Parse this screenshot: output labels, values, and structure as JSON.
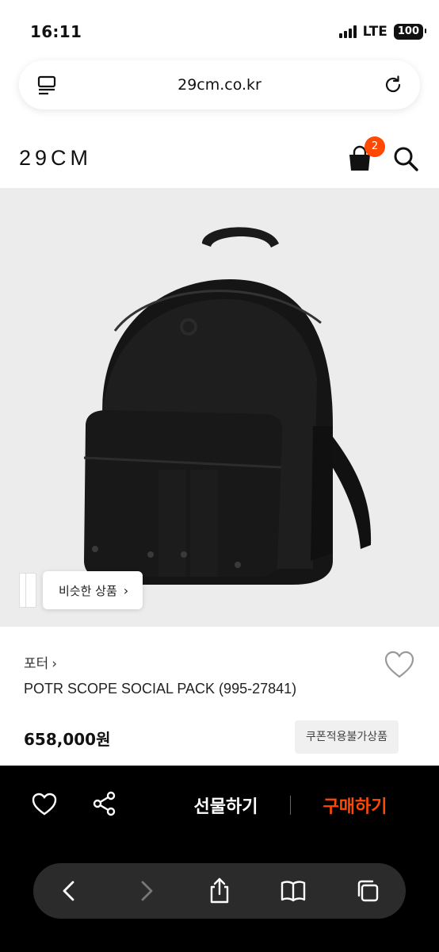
{
  "status_bar": {
    "time": "16:11",
    "network": "LTE",
    "battery": "100"
  },
  "browser": {
    "url": "29cm.co.kr",
    "menu_icon": "tab-menu-icon",
    "reload_icon": "reload-icon"
  },
  "site": {
    "logo": "29CM",
    "cart_count": "2",
    "cart_icon": "shopping-bag-icon",
    "search_icon": "search-icon"
  },
  "hero": {
    "similar_label": "비슷한 상품",
    "similar_chevron": "›"
  },
  "product": {
    "brand": "포터",
    "brand_chevron": "›",
    "name": "POTR SCOPE SOCIAL PACK (995-27841)",
    "price": "658,000원",
    "coupon_badge": "쿠폰적용불가상품"
  },
  "actions": {
    "gift_label": "선물하기",
    "buy_label": "구매하기",
    "like_icon": "heart-icon",
    "share_icon": "share-icon"
  },
  "toolbar": {
    "items": [
      "back-icon",
      "forward-icon",
      "share-icon",
      "bookmarks-icon",
      "tabs-icon"
    ]
  },
  "colors": {
    "accent": "#ff4800",
    "bottom_bar": "#000000",
    "toolbar": "#2b2b2b"
  }
}
